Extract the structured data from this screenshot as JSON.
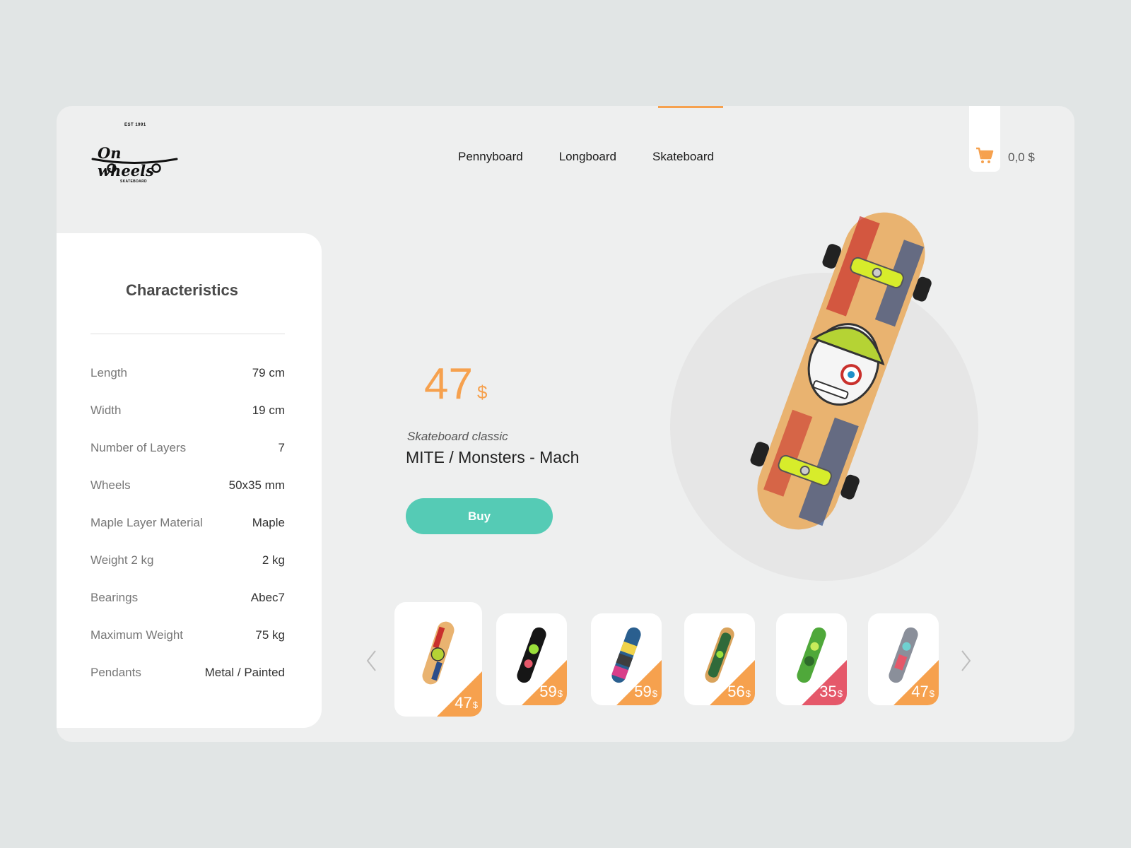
{
  "logo": {
    "est": "EST 1991",
    "name": "On wheels",
    "sub": "SKATEBOARD"
  },
  "nav": {
    "items": [
      "Pennyboard",
      "Longboard",
      "Skateboard"
    ],
    "active": "Skateboard"
  },
  "cart": {
    "icon": "cart-icon",
    "total": "0,0 $"
  },
  "characteristics": {
    "title": "Characteristics",
    "rows": [
      {
        "label": "Length",
        "value": "79 cm"
      },
      {
        "label": "Width",
        "value": "19 cm"
      },
      {
        "label": "Number of Layers",
        "value": "7"
      },
      {
        "label": "Wheels",
        "value": "50x35 mm"
      },
      {
        "label": "Maple Layer Material",
        "value": "Maple"
      },
      {
        "label": "Weight 2 kg",
        "value": "2 kg"
      },
      {
        "label": "Bearings",
        "value": "Abec7"
      },
      {
        "label": "Maximum Weight",
        "value": "75 kg"
      },
      {
        "label": "Pendants",
        "value": "Metal / Painted"
      }
    ]
  },
  "product": {
    "price": "47",
    "currency": "$",
    "category": "Skateboard classic",
    "name": "MITE / Monsters - Mach",
    "buy_label": "Buy"
  },
  "thumbnails": {
    "prev_icon": "chevron-left-icon",
    "next_icon": "chevron-right-icon",
    "items": [
      {
        "price": "47",
        "currency": "$",
        "badge_color": "#f6a14e"
      },
      {
        "price": "59",
        "currency": "$",
        "badge_color": "#f6a14e"
      },
      {
        "price": "59",
        "currency": "$",
        "badge_color": "#f6a14e"
      },
      {
        "price": "56",
        "currency": "$",
        "badge_color": "#f6a14e"
      },
      {
        "price": "35",
        "currency": "$",
        "badge_color": "#e5586a"
      },
      {
        "price": "47",
        "currency": "$",
        "badge_color": "#f6a14e"
      }
    ]
  },
  "colors": {
    "accent": "#f6a14e",
    "button": "#55cbb5",
    "sale": "#e5586a"
  }
}
